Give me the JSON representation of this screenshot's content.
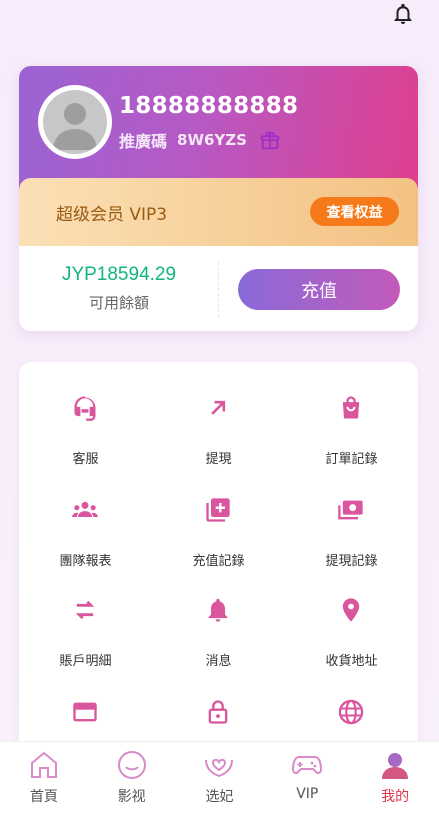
{
  "header": {
    "notification_icon": "bell-icon"
  },
  "profile": {
    "username": "18888888888",
    "referral_label": "推廣碼",
    "referral_code": "8W6YZS",
    "gift_icon": "gift-icon"
  },
  "vip": {
    "level_label": "超级会员 VIP3",
    "benefits_button": "查看权益"
  },
  "balance": {
    "amount": "JYP18594.29",
    "label": "可用餘額",
    "recharge_button": "充值"
  },
  "menu": [
    {
      "label": "客服",
      "icon": "headset-icon"
    },
    {
      "label": "提現",
      "icon": "arrow-up-right-icon"
    },
    {
      "label": "訂單記錄",
      "icon": "shopping-bag-icon"
    },
    {
      "label": "團隊報表",
      "icon": "group-icon"
    },
    {
      "label": "充值記錄",
      "icon": "add-library-icon"
    },
    {
      "label": "提現記錄",
      "icon": "money-icon"
    },
    {
      "label": "賬戶明細",
      "icon": "swap-icon"
    },
    {
      "label": "消息",
      "icon": "bell-icon"
    },
    {
      "label": "收貨地址",
      "icon": "location-pin-icon"
    },
    {
      "label": "",
      "icon": "credit-card-icon"
    },
    {
      "label": "",
      "icon": "lock-icon"
    },
    {
      "label": "",
      "icon": "globe-icon"
    }
  ],
  "tabbar": [
    {
      "label": "首頁",
      "icon": "home-icon",
      "active": false
    },
    {
      "label": "影视",
      "icon": "smile-icon",
      "active": false
    },
    {
      "label": "选妃",
      "icon": "heart-hands-icon",
      "active": false
    },
    {
      "label": "VIP",
      "icon": "gamepad-icon",
      "active": false
    },
    {
      "label": "我的",
      "icon": "user-icon",
      "active": true
    }
  ],
  "colors": {
    "accent_pink": "#d9559d",
    "header_gradient_start": "#9a63d3",
    "header_gradient_end": "#df3f8e",
    "balance_green": "#12b57c",
    "vip_button": "#f77a1a",
    "active_tab": "#e2334a"
  }
}
